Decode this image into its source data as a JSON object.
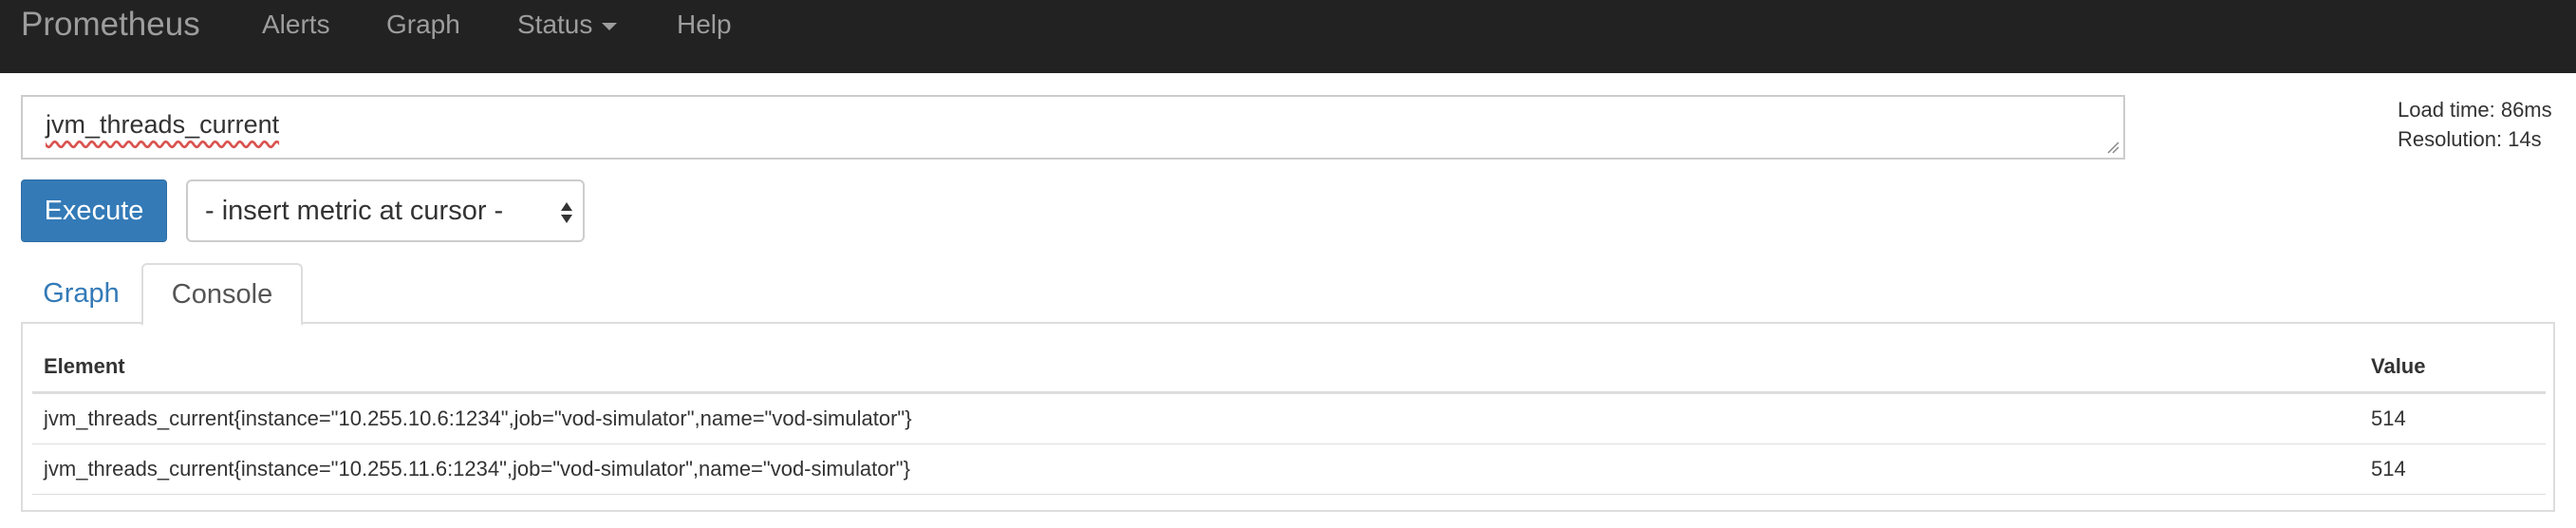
{
  "navbar": {
    "brand": "Prometheus",
    "items": [
      {
        "label": "Alerts"
      },
      {
        "label": "Graph"
      },
      {
        "label": "Status"
      },
      {
        "label": "Help"
      }
    ]
  },
  "query": {
    "expression": "jvm_threads_current"
  },
  "stats": {
    "load_time": "Load time: 86ms",
    "resolution": "Resolution: 14s"
  },
  "controls": {
    "execute_label": "Execute",
    "metric_select_value": "- insert metric at cursor -"
  },
  "tabs": [
    {
      "label": "Graph",
      "active": false
    },
    {
      "label": "Console",
      "active": true
    }
  ],
  "table": {
    "columns": [
      "Element",
      "Value"
    ],
    "rows": [
      {
        "element": "jvm_threads_current{instance=\"10.255.10.6:1234\",job=\"vod-simulator\",name=\"vod-simulator\"}",
        "value": "514"
      },
      {
        "element": "jvm_threads_current{instance=\"10.255.11.6:1234\",job=\"vod-simulator\",name=\"vod-simulator\"}",
        "value": "514"
      }
    ]
  },
  "colors": {
    "navbar_bg": "#222222",
    "navbar_text": "#9d9d9d",
    "primary": "#337ab7",
    "border": "#dddddd"
  }
}
